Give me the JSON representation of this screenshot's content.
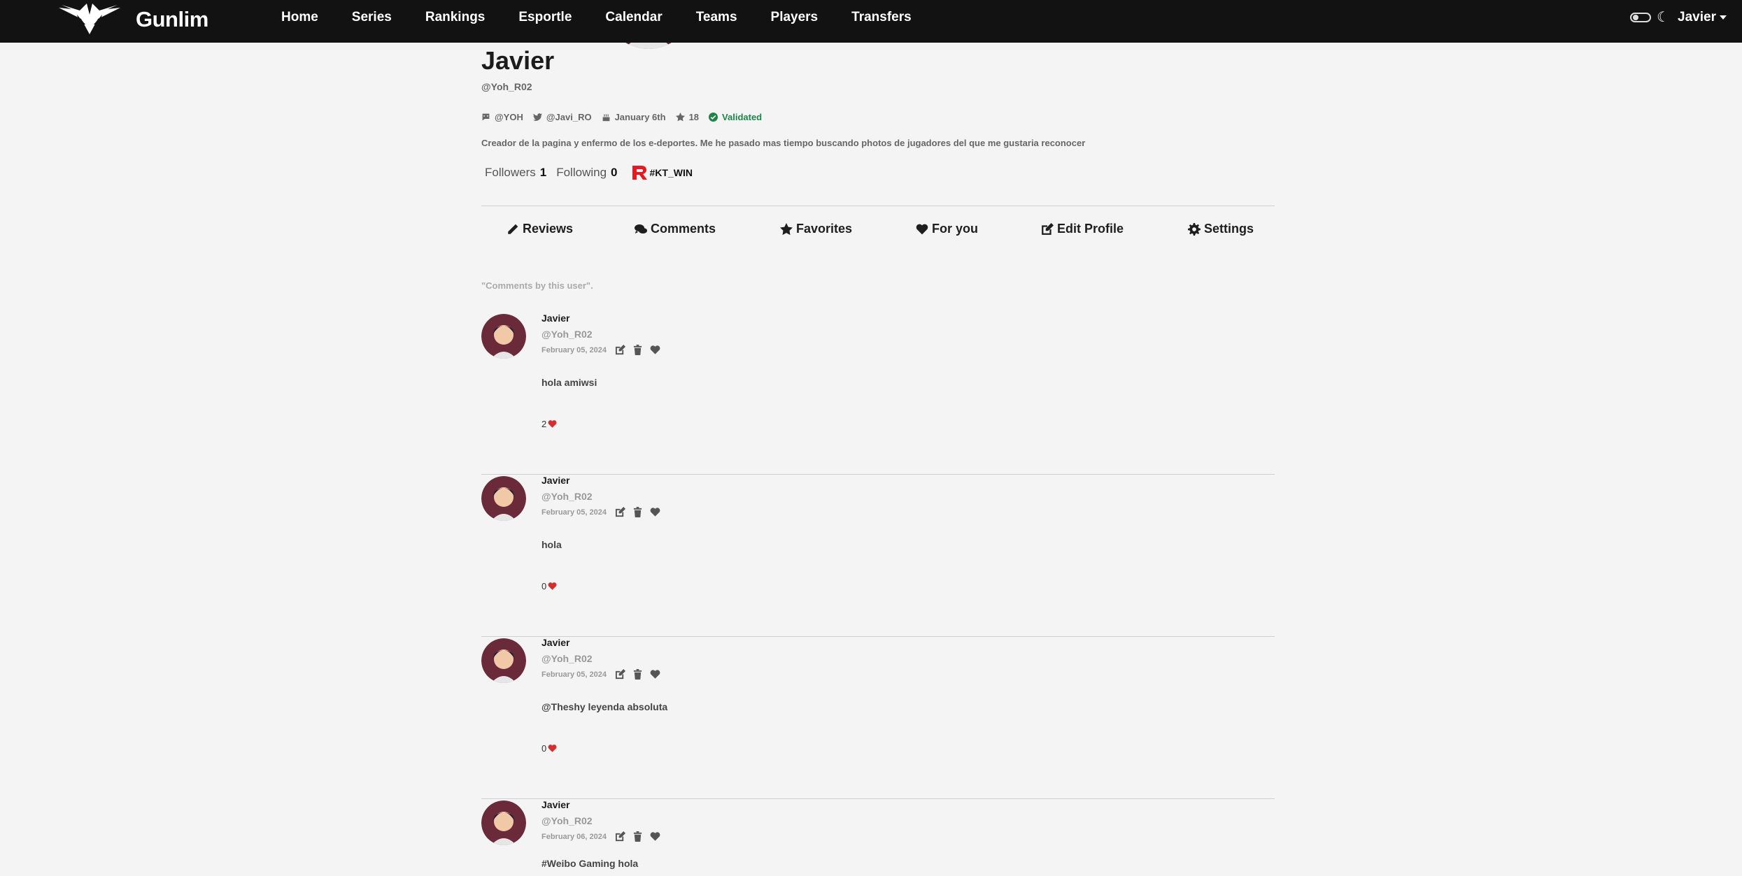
{
  "app": {
    "name": "Gunlim"
  },
  "nav": {
    "items": [
      "Home",
      "Series",
      "Rankings",
      "Esportle",
      "Calendar",
      "Teams",
      "Players",
      "Transfers"
    ],
    "user_label": "Javier"
  },
  "profile": {
    "name": "Javier",
    "handle": "@Yoh_R02",
    "meta": {
      "discord": "@YOH",
      "twitter": "@Javi_RO",
      "birthday": "January 6th",
      "stars": "18",
      "status": "Validated"
    },
    "bio": "Creador de la pagina y enfermo de los e-deportes. Me he pasado mas tiempo buscando photos de jugadores del que me gustaria reconocer",
    "followers_label": "Followers",
    "followers": "1",
    "following_label": "Following",
    "following": "0",
    "team_tag": "#KT_WIN"
  },
  "tabs": [
    "Reviews",
    "Comments",
    "Favorites",
    "For you",
    "Edit Profile",
    "Settings"
  ],
  "section_title": "\"Comments by this user\".",
  "comments": [
    {
      "name": "Javier",
      "handle": "@Yoh_R02",
      "date": "February 05, 2024",
      "text": "hola amiwsi",
      "likes": "2"
    },
    {
      "name": "Javier",
      "handle": "@Yoh_R02",
      "date": "February 05, 2024",
      "text": "hola",
      "likes": "0"
    },
    {
      "name": "Javier",
      "handle": "@Yoh_R02",
      "date": "February 05, 2024",
      "text": "@Theshy leyenda absoluta",
      "likes": "0"
    },
    {
      "name": "Javier",
      "handle": "@Yoh_R02",
      "date": "February 06, 2024",
      "text": "#Weibo Gaming hola",
      "likes": ""
    }
  ],
  "colors": {
    "navbar": "#121212",
    "background": "#f4f4f4",
    "validated": "#1e8449",
    "heart": "#d32f2f",
    "team_logo": "#e21b22"
  }
}
